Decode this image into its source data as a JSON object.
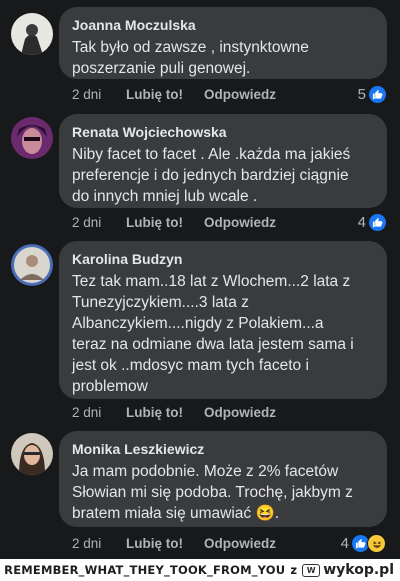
{
  "comments": [
    {
      "author": "Joanna Moczulska",
      "text": "Tak było od zawsze , instynktowne\nposzerzanie puli genowej.",
      "time": "2 dni",
      "like_label": "Lubię to!",
      "reply_label": "Odpowiedz",
      "reaction_count": "5",
      "reactions": [
        "like-icon"
      ]
    },
    {
      "author": "Renata Wojciechowska",
      "text": "Niby facet to facet . Ale .każda ma jakieś\npreferencje i do jednych bardziej ciągnie\ndo innych mniej lub wcale .",
      "time": "2 dni",
      "like_label": "Lubię to!",
      "reply_label": "Odpowiedz",
      "reaction_count": "4",
      "reactions": [
        "like-icon"
      ]
    },
    {
      "author": "Karolina Budzyn",
      "text": "Tez tak mam..18 lat z Wlochem...2 lata z\nTunezyjczykiem....3 lata z\nAlbanczykiem....nigdy z Polakiem...a\nteraz na odmiane dwa lata jestem sama i\njest ok ..mdosyc mam tych faceto i\nproblemow",
      "time": "2 dni",
      "like_label": "Lubię to!",
      "reply_label": "Odpowiedz",
      "reaction_count": "",
      "reactions": []
    },
    {
      "author": "Monika Leszkiewicz",
      "text": "Ja mam podobnie. Może z 2% facetów\nSłowian mi się podoba. Trochę, jakbym z\nbratem miała się umawiać 😆.",
      "time": "2 dni",
      "like_label": "Lubię to!",
      "reply_label": "Odpowiedz",
      "reaction_count": "4",
      "reactions": [
        "like-icon",
        "haha-icon"
      ]
    }
  ],
  "footer": {
    "username": "REMEMBER_WHAT_THEY_TOOK_FROM_YOU",
    "via": "z",
    "brand": "wykop.pl"
  }
}
